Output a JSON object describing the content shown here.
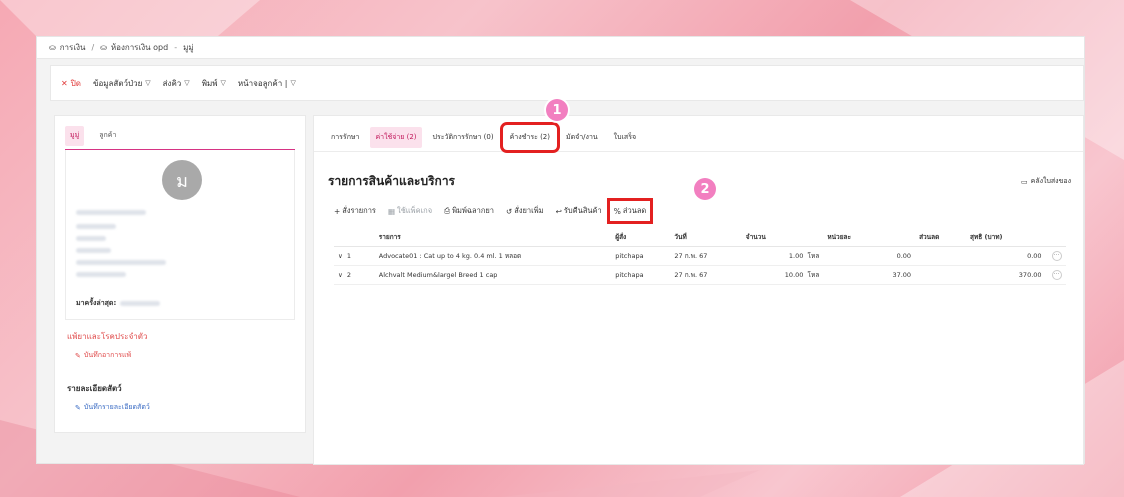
{
  "breadcrumb": {
    "items": [
      "การเงิน",
      "ห้องการเงิน opd",
      "มูมู่"
    ],
    "separator": "/"
  },
  "toolbar": {
    "close_label": "ปิด",
    "pet_info_label": "ข้อมูลสัตว์ป่วย",
    "send_label": "ส่งคิว",
    "print_label": "พิมพ์",
    "customer_page_label": "หน้าจอลูกค้า |"
  },
  "left_panel": {
    "tabs": [
      "มูมู่",
      "ลูกค้า"
    ],
    "avatar_initial": "ม",
    "last_visit_label": "มาครั้งล่าสุด:",
    "allergy_label": "แพ้ยาและโรคประจำตัว",
    "allergy_link": "บันทึกอาการแพ้",
    "pet_detail_title": "รายละเอียดสัตว์",
    "pet_detail_link": "บันทึกรายละเอียดสัตว์"
  },
  "main": {
    "tabs": [
      "การรักษา",
      "ค่าใช้จ่าย (2)",
      "ประวัติการรักษา (0)",
      "ค้างชำระ (2)",
      "มัดจำ/งาน",
      "ใบเสร็จ"
    ],
    "section_title": "รายการสินค้าและบริการ",
    "hold_link": "คลังใบส่งของ",
    "actions": {
      "order": "สั่งรายการ",
      "use_package": "ใช้แพ็คเกจ",
      "print_label": "พิมพ์ฉลากยา",
      "add_drug": "สั่งยาเพิ่ม",
      "return": "รับคืนสินค้า",
      "discount": "ส่วนลด"
    },
    "table": {
      "headers": [
        "รายการ",
        "ผู้สั่ง",
        "วันที่",
        "จำนวน",
        "หน่วยละ",
        "ส่วนลด",
        "สุทธิ (บาท)"
      ],
      "rows": [
        {
          "no": "1",
          "item": "Advocate01 : Cat up to 4 kg. 0.4 ml. 1 หลอด",
          "by": "pitchapa",
          "date": "27 ก.พ. 67",
          "qty": "1.00",
          "unit": "โหล",
          "price": "0.00",
          "discount": "",
          "net": "0.00"
        },
        {
          "no": "2",
          "item": "Alchvalt Medium&largel Breed 1 cap",
          "by": "pitchapa",
          "date": "27 ก.พ. 67",
          "qty": "10.00",
          "unit": "โหล",
          "price": "37.00",
          "discount": "",
          "net": "370.00"
        }
      ]
    }
  },
  "callouts": [
    "1",
    "2"
  ],
  "colors": {
    "accent": "#c2185b",
    "highlight": "#e32020",
    "badge": "#f27fc0",
    "danger": "#e04a4a",
    "link": "#3b6cc4"
  }
}
